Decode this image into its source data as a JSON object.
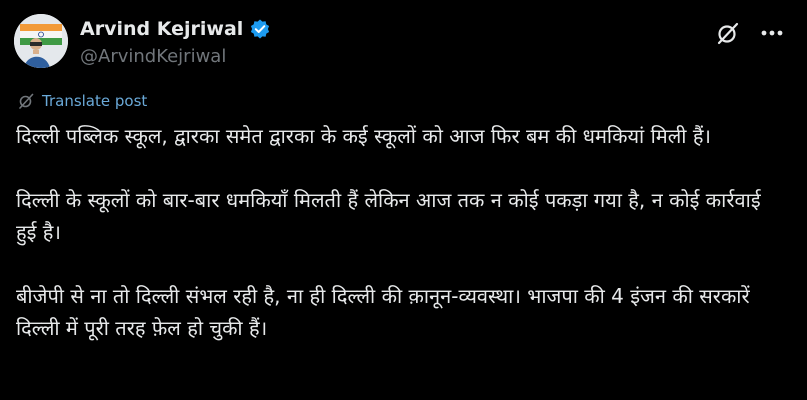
{
  "colors": {
    "background": "#000000",
    "text": "#e7e9ea",
    "muted": "#71767b",
    "link": "#6aa9d8",
    "verified": "#1d9bf0"
  },
  "author": {
    "display_name": "Arvind Kejriwal",
    "handle": "@ArvindKejriwal",
    "verified": true
  },
  "header_icons": [
    "grok-icon",
    "more-icon"
  ],
  "translate": {
    "label": "Translate post"
  },
  "post": {
    "paragraphs": [
      "दिल्ली पब्लिक स्कूल, द्वारका समेत द्वारका के कई स्कूलों को आज फिर बम की धमकियां मिली हैं।",
      "दिल्ली के स्कूलों को बार-बार धमकियाँ मिलती हैं लेकिन आज तक न कोई पकड़ा गया है, न कोई कार्रवाई हुई है।",
      "बीजेपी से ना तो दिल्ली संभल रही है, ना ही दिल्ली की क़ानून-व्यवस्था। भाजपा की 4 इंजन की सरकारें दिल्ली में पूरी तरह फ़ेल हो चुकी हैं।"
    ]
  }
}
